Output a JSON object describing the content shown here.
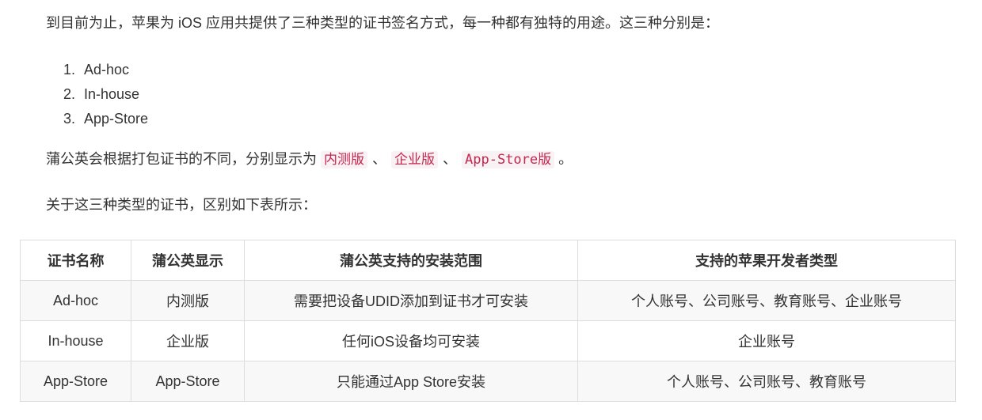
{
  "intro": "到目前为止，苹果为 iOS 应用共提供了三种类型的证书签名方式，每一种都有独特的用途。这三种分别是：",
  "types": [
    {
      "num": "1.",
      "name": "Ad-hoc"
    },
    {
      "num": "2.",
      "name": "In-house"
    },
    {
      "num": "3.",
      "name": "App-Store"
    }
  ],
  "display": {
    "prefix": "蒲公英会根据打包证书的不同，分别显示为",
    "tags": [
      "内测版",
      "企业版",
      "App-Store版"
    ],
    "separator": "、",
    "suffix": "。"
  },
  "diff_intro": "关于这三种类型的证书，区别如下表所示：",
  "table": {
    "headers": [
      "证书名称",
      "蒲公英显示",
      "蒲公英支持的安装范围",
      "支持的苹果开发者类型"
    ],
    "rows": [
      [
        "Ad-hoc",
        "内测版",
        "需要把设备UDID添加到证书才可安装",
        "个人账号、公司账号、教育账号、企业账号"
      ],
      [
        "In-house",
        "企业版",
        "任何iOS设备均可安装",
        "企业账号"
      ],
      [
        "App-Store",
        "App-Store",
        "只能通过App Store安装",
        "个人账号、公司账号、教育账号"
      ]
    ]
  },
  "colors": {
    "text": "#333333",
    "code_text": "#c7254e",
    "code_bg": "#f9f2f4",
    "table_border": "#dddddd",
    "row_stripe": "#f8f8f8"
  }
}
